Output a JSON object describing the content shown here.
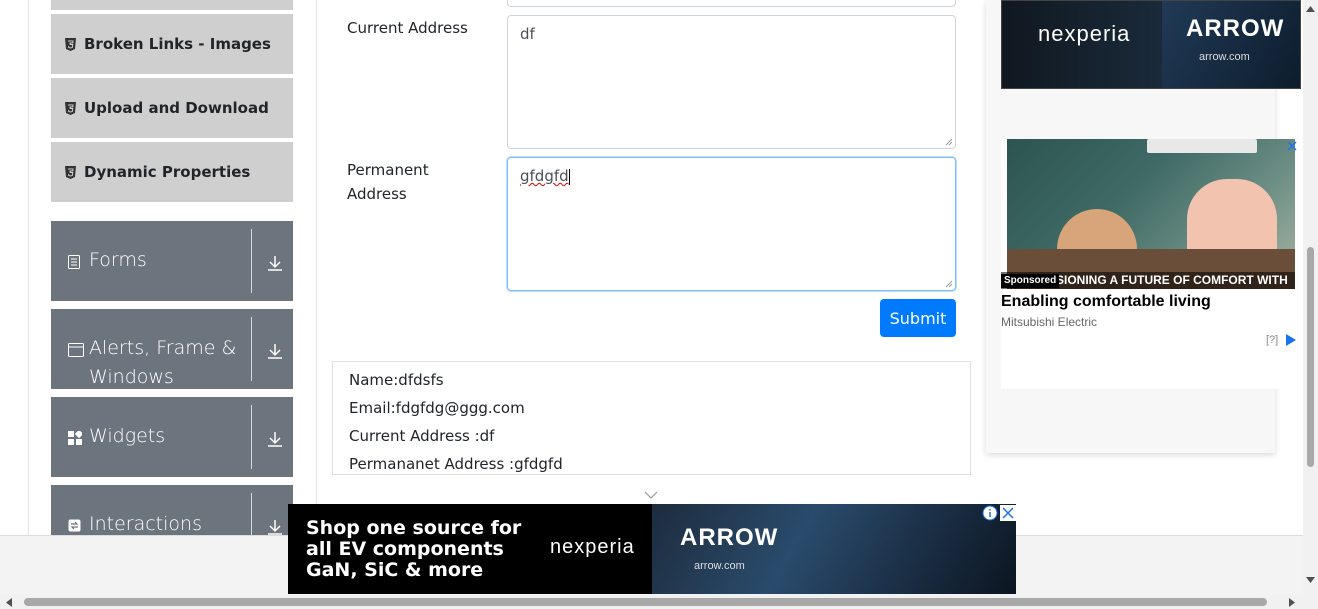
{
  "sidebar": {
    "sub_items": [
      {
        "label": "Broken Links - Images"
      },
      {
        "label": "Upload and Download"
      },
      {
        "label": "Dynamic Properties"
      }
    ],
    "groups": [
      {
        "label": "Forms"
      },
      {
        "label": "Alerts, Frame &"
      },
      {
        "label": "Widgets"
      },
      {
        "label": "Interactions"
      }
    ],
    "alerts_label_line2": "Windows"
  },
  "form": {
    "current_address_label": "Current Address",
    "current_address_value": "df",
    "permanent_address_label_1": "Permanent",
    "permanent_address_label_2": "Address",
    "permanent_address_value": "gfdgfd",
    "submit_label": "Submit"
  },
  "output": {
    "name": "Name:dfdsfs",
    "email": "Email:fdgfdg@ggg.com",
    "current_address": "Current Address :df",
    "permanent_address": "Permananet Address :gfdgfd"
  },
  "ads": {
    "top": {
      "brand_left": "nexperia",
      "brand_right": "ARROW",
      "domain": "arrow.com"
    },
    "side": {
      "sponsored": "Sponsored",
      "caption": "SIONING A FUTURE OF COMFORT WITH",
      "headline": "Enabling comfortable living",
      "brand": "Mitsubishi Electric",
      "marker": "[?]"
    },
    "bottom": {
      "headline": "Shop one source for all EV components GaN, SiC & more",
      "brand": "nexperia",
      "brand_right": "ARROW",
      "domain": "arrow.com"
    }
  },
  "colors": {
    "primary": "#007bff",
    "group_bg": "#6c757d",
    "sub_item_bg": "#cfcfcf"
  }
}
